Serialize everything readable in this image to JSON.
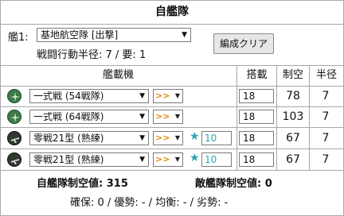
{
  "title": "自艦隊",
  "fleet": {
    "label": "艦1:",
    "selected": "基地航空隊 [出撃]",
    "radius_text": "戦闘行動半径: 7 / 要: 1",
    "clear_label": "編成クリア"
  },
  "headers": {
    "equipment": "艦載機",
    "slot": "搭載",
    "air_power": "制空",
    "radius": "半径"
  },
  "rows": [
    {
      "equipment": "一式戦 (54戦隊)",
      "proficiency": ">>",
      "improvement": "",
      "slot": "18",
      "air_power": "78",
      "radius": "7",
      "icon": "army-fighter-icon"
    },
    {
      "equipment": "一式戦 (64戦隊)",
      "proficiency": ">>",
      "improvement": "",
      "slot": "18",
      "air_power": "103",
      "radius": "7",
      "icon": "army-fighter-icon"
    },
    {
      "equipment": "零戦21型 (熟練)",
      "proficiency": ">>",
      "improvement": "10",
      "slot": "18",
      "air_power": "67",
      "radius": "7",
      "icon": "carrier-fighter-icon"
    },
    {
      "equipment": "零戦21型 (熟練)",
      "proficiency": ">>",
      "improvement": "10",
      "slot": "18",
      "air_power": "67",
      "radius": "7",
      "icon": "carrier-fighter-icon"
    }
  ],
  "summary": {
    "own": "自艦隊制空値: 315",
    "enemy": "敵艦隊制空値: 0",
    "status": "確保: 0 / 優勢: - / 均衡: - / 劣勢: -"
  },
  "colors": {
    "border": "#a8a8a8",
    "proficiency": "#e08a00",
    "improvement": "#2aa7b5",
    "icon_green": "#3c7a4a",
    "icon_dark": "#2f3b2f"
  }
}
